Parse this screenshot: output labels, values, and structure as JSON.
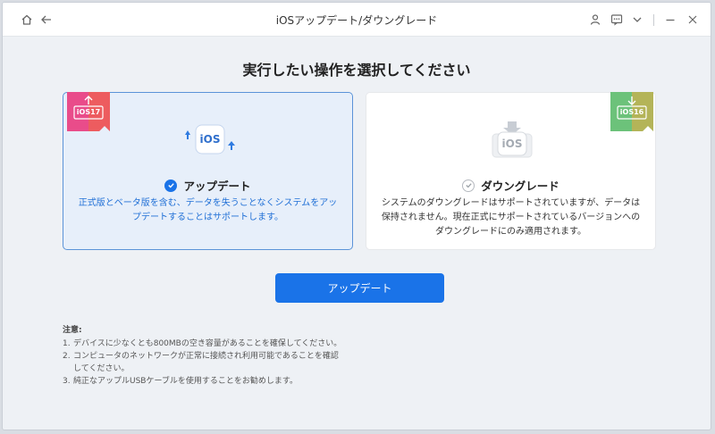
{
  "window": {
    "title": "iOSアップデート/ダウングレード"
  },
  "main": {
    "heading": "実行したい操作を選択してください",
    "cards": [
      {
        "badge": "iOS17",
        "icon_label": "iOS",
        "title": "アップデート",
        "desc_line1": "正式版とベータ版を含む、データを失うことなくシステムをアッ",
        "desc_line2": "プデートすることはサポートします。",
        "selected": true
      },
      {
        "badge": "iOS16",
        "icon_label": "iOS",
        "title": "ダウングレード",
        "desc_line1": "システムのダウングレードはサポートされていますが、データは",
        "desc_line2": "保持されません。現在正式にサポートされているバージョンへの",
        "desc_line3": "ダウングレードにのみ適用されます。",
        "selected": false
      }
    ],
    "action_button": "アップデート"
  },
  "notes": {
    "title": "注意:",
    "items": [
      {
        "num": "1.",
        "text": "デバイスに少なくとも800MBの空き容量があることを確保してください。"
      },
      {
        "num": "2.",
        "text": "コンピュータのネットワークが正常に接続され利用可能であることを確認",
        "text2": "してください。"
      },
      {
        "num": "3.",
        "text": "純正なアップルUSBケーブルを使用することをお勧めします。"
      }
    ]
  },
  "colors": {
    "accent": "#1a73e8",
    "selected_border": "#5b93d8",
    "selected_bg": "#e7effa",
    "ribbon_update": "#e94c8a",
    "ribbon_downgrade": "#6cc27a"
  },
  "icons": [
    "home-icon",
    "back-arrow-icon",
    "user-icon",
    "feedback-icon",
    "chevron-down-icon",
    "minimize-icon",
    "close-icon"
  ]
}
